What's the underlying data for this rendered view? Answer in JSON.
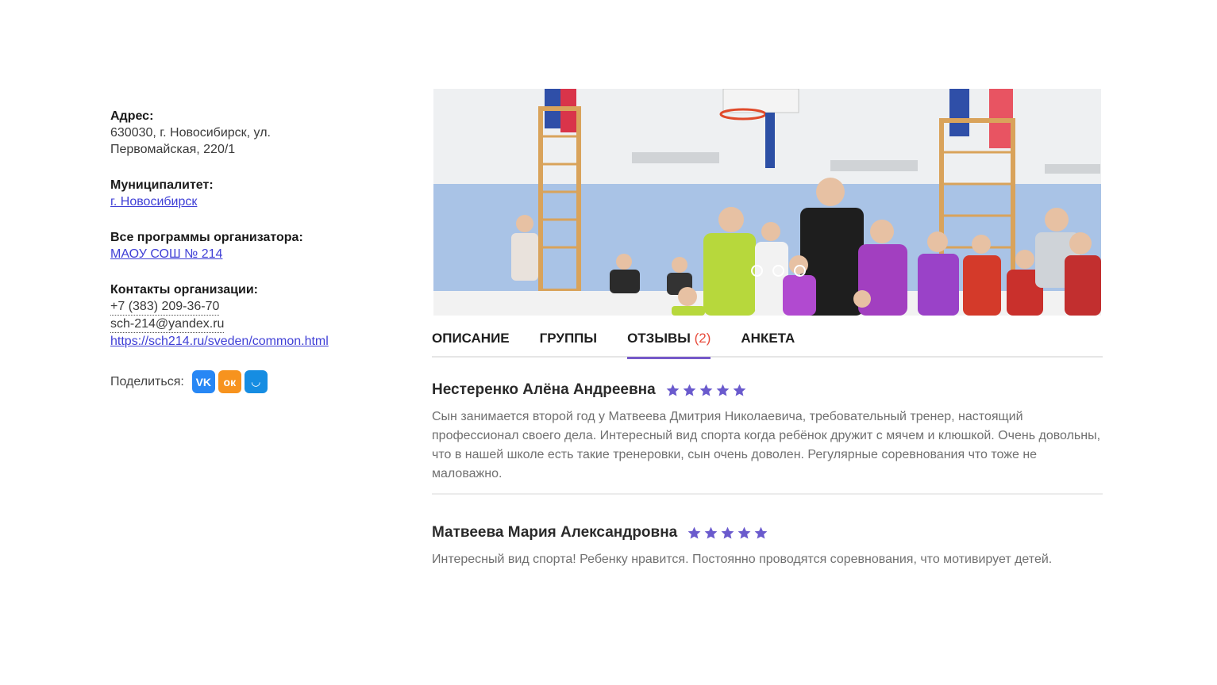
{
  "info": {
    "address_label": "Адрес:",
    "address_line1": "630030, г. Новосибирск, ул.",
    "address_line2": "Первомайская, 220/1",
    "municipality_label": "Муниципалитет:",
    "municipality_link": "г. Новосибирск",
    "programs_label": "Все программы организатора:",
    "programs_link": "МАОУ СОШ № 214",
    "contacts_label": "Контакты организации:",
    "phone": "+7 (383) 209-36-70",
    "email": "sch-214@yandex.ru",
    "website": "https://sch214.ru/sveden/common.html",
    "share_label": "Поделиться:",
    "share_buttons": [
      {
        "icon": "vk-icon",
        "glyph": "VK",
        "color": "#2787f5"
      },
      {
        "icon": "odnoklassniki-icon",
        "glyph": "ок",
        "color": "#f7931e"
      },
      {
        "icon": "mymail-icon",
        "glyph": "◡",
        "color": "#168de2"
      }
    ]
  },
  "gallery": {
    "slide_count": 3
  },
  "tabs": [
    {
      "label": "ОПИСАНИЕ",
      "active": false
    },
    {
      "label": "ГРУППЫ",
      "active": false
    },
    {
      "label": "ОТЗЫВЫ",
      "count": "(2)",
      "active": true
    },
    {
      "label": "АНКЕТА",
      "active": false
    }
  ],
  "reviews": [
    {
      "author": "Нестеренко Алёна Андреевна",
      "rating": 5,
      "text": "Сын занимается второй год у Матвеева Дмитрия Николаевича, требовательный тренер, настоящий профессионал своего дела. Интересный вид спорта когда ребёнок дружит с мячем и клюшкой. Очень довольны, что в нашей школе есть такие тренеровки, сын очень доволен. Регулярные соревнования что тоже не маловажно."
    },
    {
      "author": "Матвеева Мария Александровна",
      "rating": 5,
      "text": "Интересный вид спорта! Ребенку нравится. Постоянно проводятся соревнования, что мотивирует детей."
    }
  ],
  "colors": {
    "accent": "#7659c9",
    "star": "#6a5acd",
    "link": "#3f3fd6",
    "count": "#e84b3c"
  }
}
